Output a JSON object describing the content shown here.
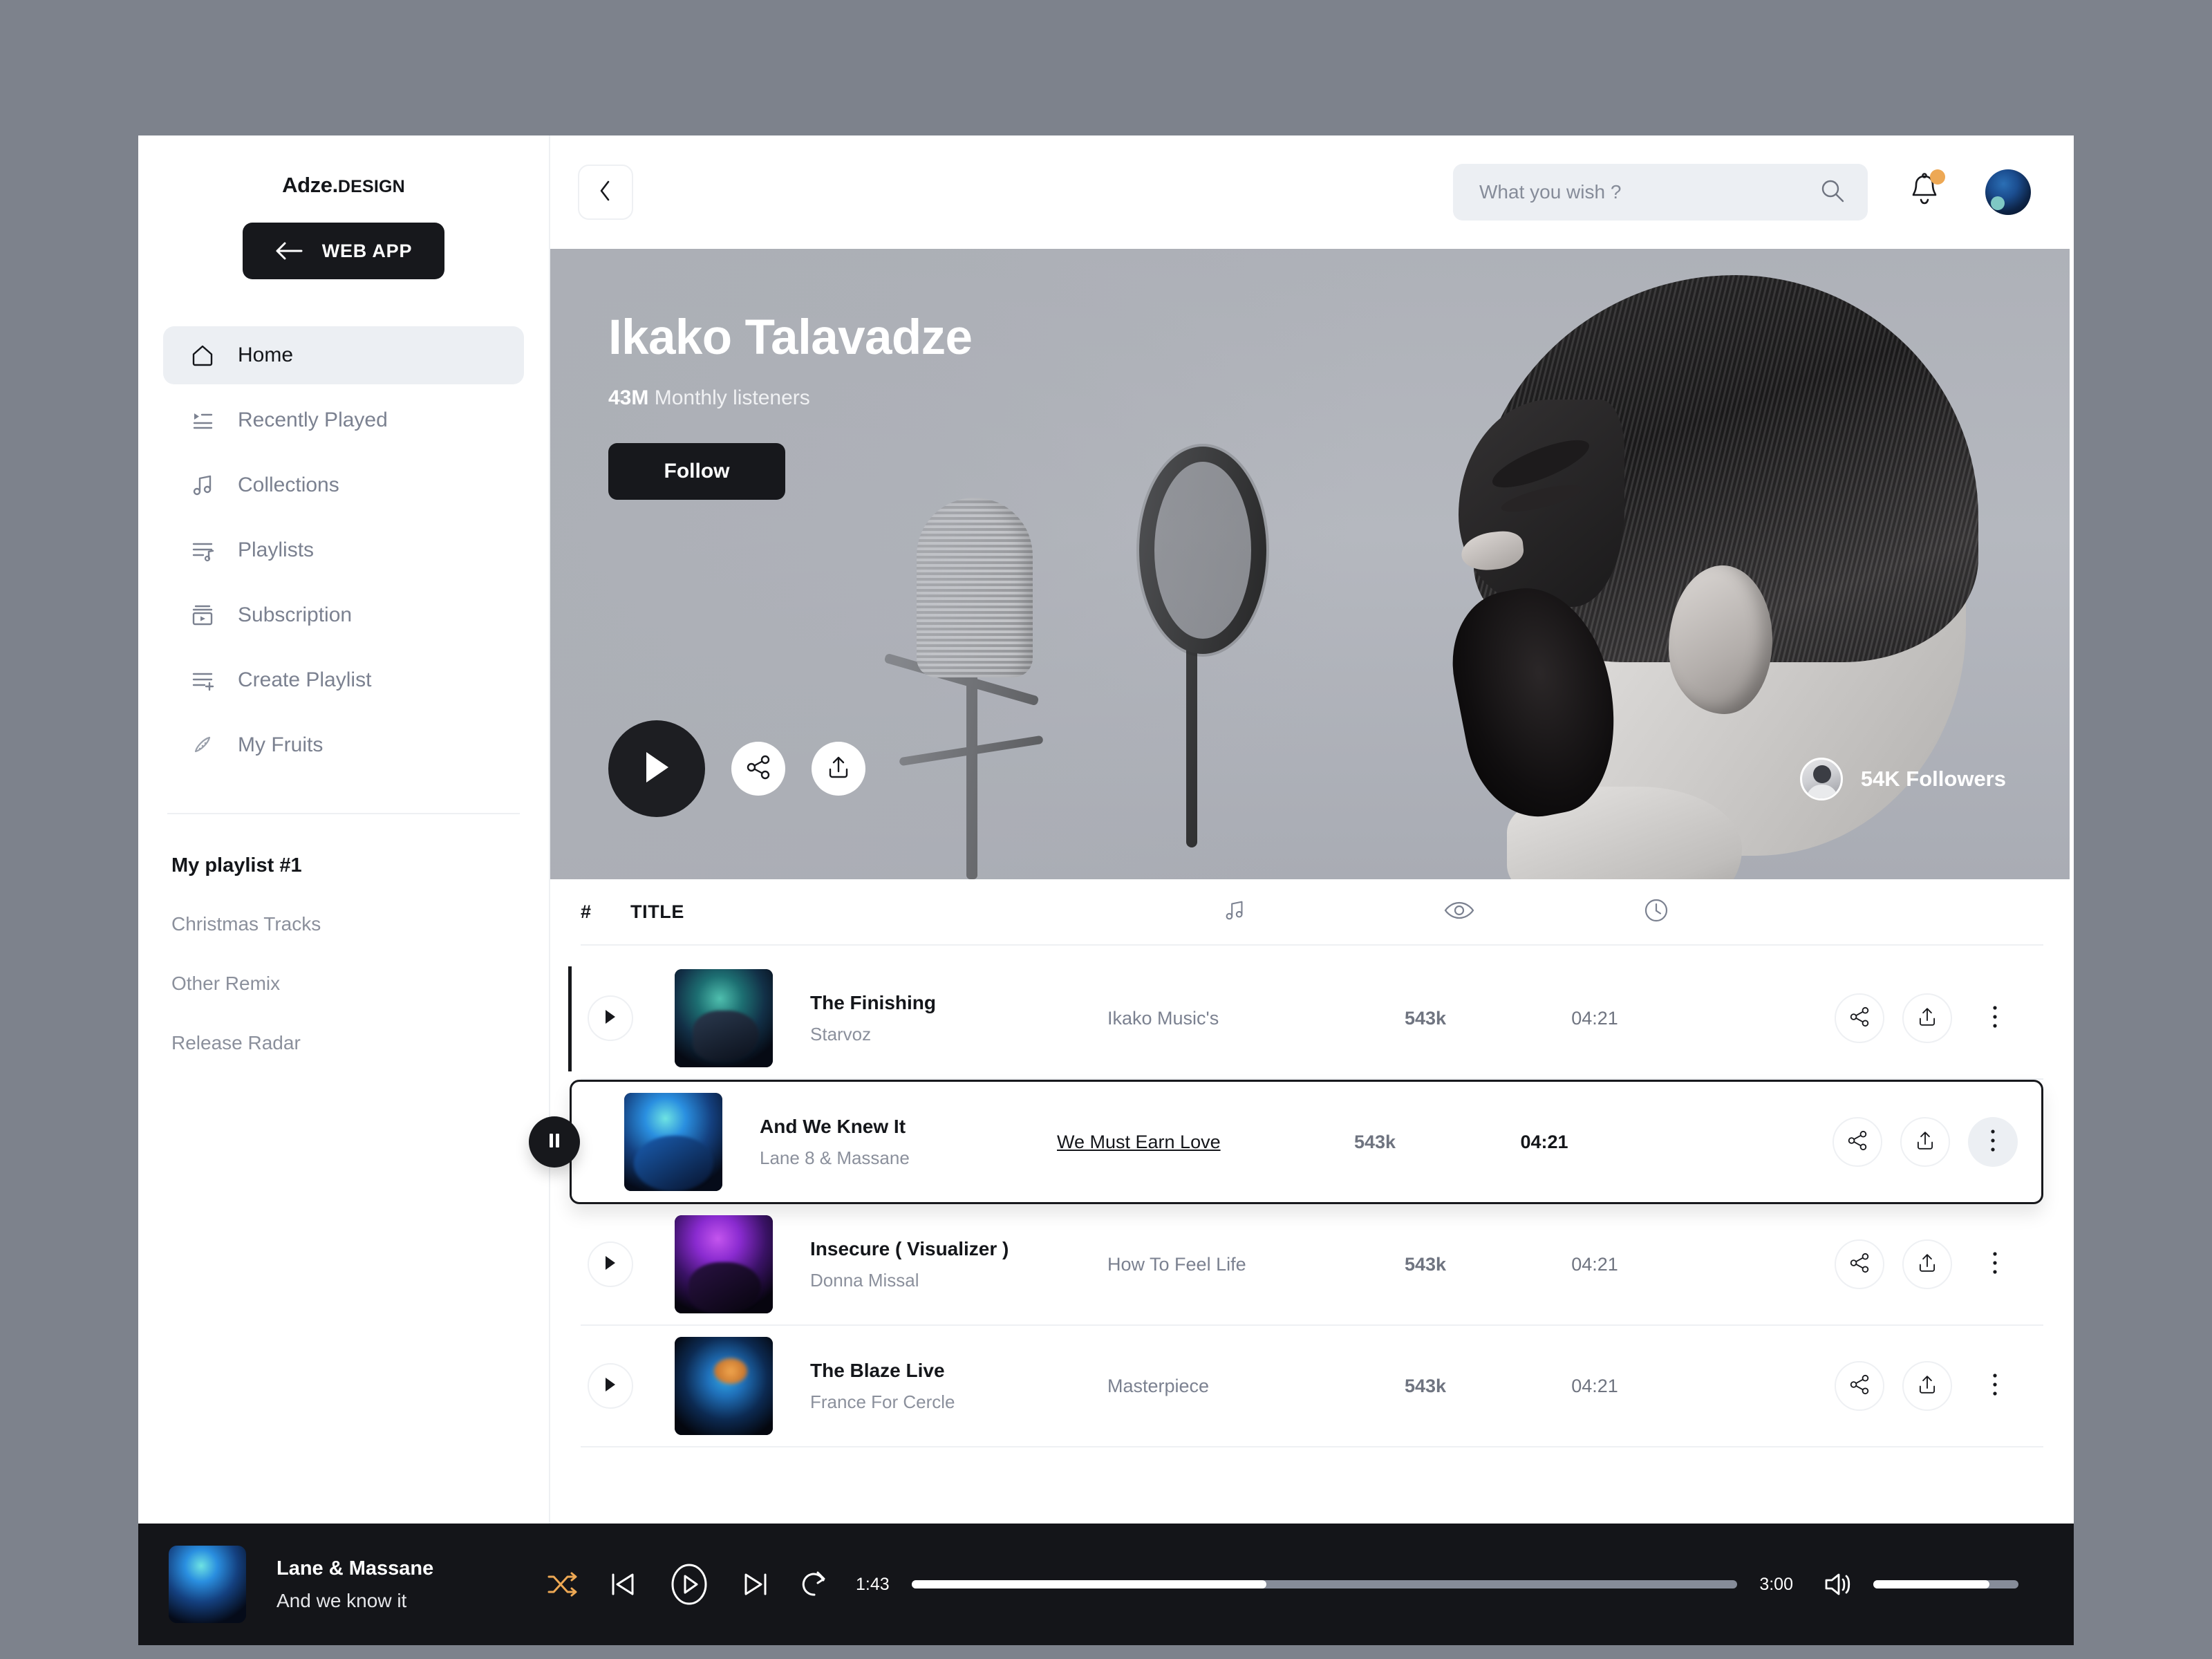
{
  "brand": {
    "name": "Adze.",
    "suffix": "DESIGN"
  },
  "sidebar": {
    "web_app_button": "WEB APP",
    "items": [
      {
        "label": "Home",
        "icon": "home-icon",
        "active": true
      },
      {
        "label": "Recently Played",
        "icon": "recently-played-icon",
        "active": false
      },
      {
        "label": "Collections",
        "icon": "music-note-icon",
        "active": false
      },
      {
        "label": "Playlists",
        "icon": "playlist-icon",
        "active": false
      },
      {
        "label": "Subscription",
        "icon": "subscription-icon",
        "active": false
      },
      {
        "label": "Create Playlist",
        "icon": "add-playlist-icon",
        "active": false
      },
      {
        "label": "My Fruits",
        "icon": "watermelon-icon",
        "active": false
      }
    ],
    "playlists": {
      "title": "My playlist #1",
      "items": [
        "Christmas Tracks",
        "Other Remix",
        "Release Radar"
      ]
    }
  },
  "topbar": {
    "back_icon": "chevron-left-icon",
    "search": {
      "placeholder": "What you wish ?",
      "value": "",
      "icon": "search-icon"
    },
    "notifications_icon": "bell-icon",
    "avatar": "user-avatar"
  },
  "hero": {
    "artist": "Ikako Talavadze",
    "listeners_count": "43M",
    "listeners_label": "Monthly listeners",
    "follow_button": "Follow",
    "play_icon": "play-icon",
    "share_icon": "share-icon",
    "upload_icon": "upload-icon",
    "followers": "54K Followers"
  },
  "table": {
    "headers": {
      "number": "#",
      "title": "TITLE",
      "album_icon": "music-note-icon",
      "plays_icon": "eye-icon",
      "duration_icon": "clock-icon"
    },
    "rows": [
      {
        "title": "The Finishing",
        "artist": "Starvoz",
        "album": "Ikako Music's",
        "album_is_link": false,
        "plays": "543k",
        "duration": "04:21",
        "playing": false,
        "cover": "c1"
      },
      {
        "title": "And We Knew It",
        "artist": "Lane 8 & Massane",
        "album": "We Must Earn Love",
        "album_is_link": true,
        "plays": "543k",
        "duration": "04:21",
        "playing": true,
        "cover": "c2"
      },
      {
        "title": "Insecure ( Visualizer )",
        "artist": "Donna Missal",
        "album": "How To Feel Life",
        "album_is_link": false,
        "plays": "543k",
        "duration": "04:21",
        "playing": false,
        "cover": "c3"
      },
      {
        "title": "The Blaze Live",
        "artist": "France For Cercle",
        "album": "Masterpiece",
        "album_is_link": false,
        "plays": "543k",
        "duration": "04:21",
        "playing": false,
        "cover": "c4"
      }
    ]
  },
  "player": {
    "artist": "Lane & Massane",
    "track": "And we know it",
    "current_time": "1:43",
    "total_time": "3:00",
    "progress_percent": 43,
    "volume_percent": 80,
    "shuffle_icon": "shuffle-icon",
    "previous_icon": "previous-icon",
    "play_icon": "play-icon",
    "next_icon": "next-icon",
    "repeat_icon": "repeat-icon",
    "volume_icon": "volume-icon"
  },
  "colors": {
    "accent_dark": "#17181c",
    "accent_orange": "#eda854",
    "background": "#7d828c",
    "muted": "#8b909c"
  }
}
